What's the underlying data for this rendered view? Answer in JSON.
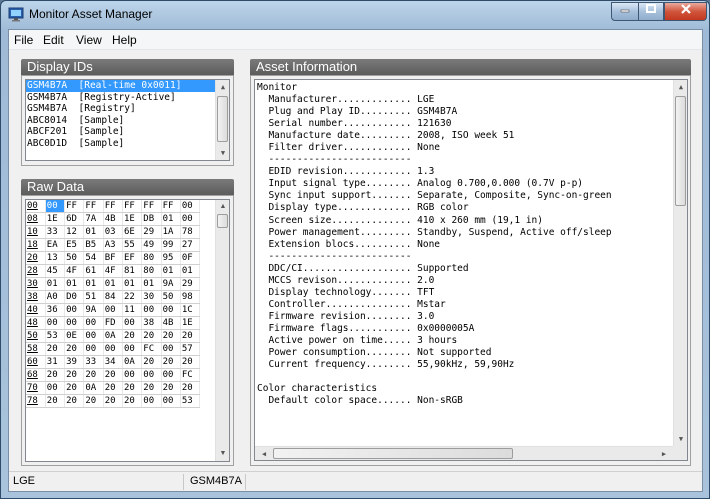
{
  "window": {
    "title": "Monitor Asset Manager"
  },
  "menu": [
    "File",
    "Edit",
    "View",
    "Help"
  ],
  "display_ids": {
    "header": "Display IDs",
    "items": [
      {
        "id": "GSM4B7A",
        "desc": "[Real-time 0x0011]",
        "selected": true
      },
      {
        "id": "GSM4B7A",
        "desc": "[Registry-Active]",
        "selected": false
      },
      {
        "id": "GSM4B7A",
        "desc": "[Registry]",
        "selected": false
      },
      {
        "id": "ABC8014",
        "desc": "[Sample]",
        "selected": false
      },
      {
        "id": "ABCF201",
        "desc": "[Sample]",
        "selected": false
      },
      {
        "id": "ABC0D1D",
        "desc": "[Sample]",
        "selected": false
      }
    ]
  },
  "raw_data": {
    "header": "Raw Data",
    "rows": [
      [
        "00",
        "00",
        "FF",
        "FF",
        "FF",
        "FF",
        "FF",
        "FF",
        "00"
      ],
      [
        "08",
        "1E",
        "6D",
        "7A",
        "4B",
        "1E",
        "DB",
        "01",
        "00"
      ],
      [
        "10",
        "33",
        "12",
        "01",
        "03",
        "6E",
        "29",
        "1A",
        "78"
      ],
      [
        "18",
        "EA",
        "E5",
        "B5",
        "A3",
        "55",
        "49",
        "99",
        "27"
      ],
      [
        "20",
        "13",
        "50",
        "54",
        "BF",
        "EF",
        "80",
        "95",
        "0F"
      ],
      [
        "28",
        "45",
        "4F",
        "61",
        "4F",
        "81",
        "80",
        "01",
        "01"
      ],
      [
        "30",
        "01",
        "01",
        "01",
        "01",
        "01",
        "01",
        "9A",
        "29"
      ],
      [
        "38",
        "A0",
        "D0",
        "51",
        "84",
        "22",
        "30",
        "50",
        "98"
      ],
      [
        "40",
        "36",
        "00",
        "9A",
        "00",
        "11",
        "00",
        "00",
        "1C"
      ],
      [
        "48",
        "00",
        "00",
        "00",
        "FD",
        "00",
        "38",
        "4B",
        "1E"
      ],
      [
        "50",
        "53",
        "0E",
        "00",
        "0A",
        "20",
        "20",
        "20",
        "20"
      ],
      [
        "58",
        "20",
        "20",
        "00",
        "00",
        "00",
        "FC",
        "00",
        "57"
      ],
      [
        "60",
        "31",
        "39",
        "33",
        "34",
        "0A",
        "20",
        "20",
        "20"
      ],
      [
        "68",
        "20",
        "20",
        "20",
        "20",
        "00",
        "00",
        "00",
        "FC"
      ],
      [
        "70",
        "00",
        "20",
        "0A",
        "20",
        "20",
        "20",
        "20",
        "20"
      ],
      [
        "78",
        "20",
        "20",
        "20",
        "20",
        "20",
        "00",
        "00",
        "53"
      ]
    ]
  },
  "asset_info": {
    "header": "Asset Information",
    "lines": [
      "Monitor",
      "  Manufacturer............. LGE",
      "  Plug and Play ID......... GSM4B7A",
      "  Serial number............ 121630",
      "  Manufacture date......... 2008, ISO week 51",
      "  Filter driver............ None",
      "  -------------------------",
      "  EDID revision............ 1.3",
      "  Input signal type........ Analog 0.700,0.000 (0.7V p-p)",
      "  Sync input support....... Separate, Composite, Sync-on-green",
      "  Display type............. RGB color",
      "  Screen size.............. 410 x 260 mm (19,1 in)",
      "  Power management......... Standby, Suspend, Active off/sleep",
      "  Extension blocs.......... None",
      "  -------------------------",
      "  DDC/CI................... Supported",
      "  MCCS revison............. 2.0",
      "  Display technology....... TFT",
      "  Controller............... Mstar",
      "  Firmware revision........ 3.0",
      "  Firmware flags........... 0x0000005A",
      "  Active power on time..... 3 hours",
      "  Power consumption........ Not supported",
      "  Current frequency........ 55,90kHz, 59,90Hz",
      "",
      "Color characteristics",
      "  Default color space...... Non-sRGB"
    ]
  },
  "status": {
    "left": "LGE",
    "right": "GSM4B7A"
  },
  "colors": {
    "selection": "#3399ff",
    "group_header": "#666666"
  }
}
